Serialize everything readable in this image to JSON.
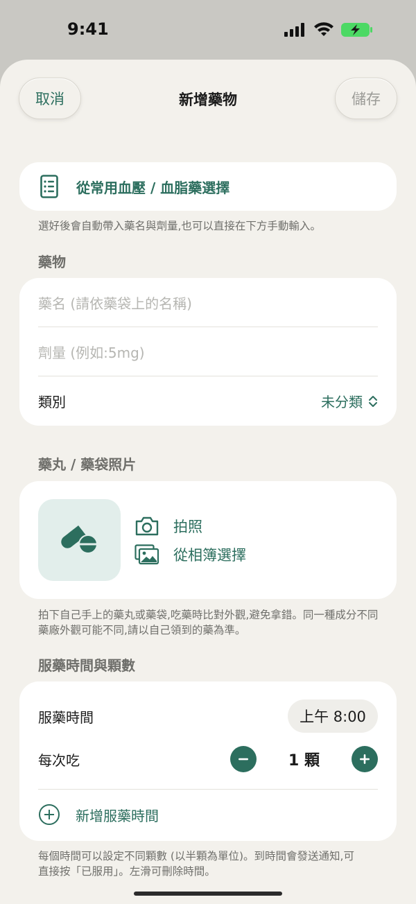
{
  "status": {
    "time": "9:41"
  },
  "nav": {
    "cancel": "取消",
    "title": "新增藥物",
    "save": "儲存"
  },
  "picker": {
    "label": "從常用血壓 / 血脂藥選擇",
    "hint": "選好後會自動帶入藥名與劑量,也可以直接在下方手動輸入。"
  },
  "medication": {
    "section_title": "藥物",
    "name_placeholder": "藥名 (請依藥袋上的名稱)",
    "dose_placeholder": "劑量 (例如:5mg)",
    "category_label": "類別",
    "category_value": "未分類"
  },
  "photo": {
    "section_title": "藥丸 / 藥袋照片",
    "take_photo": "拍照",
    "choose_album": "從相簿選擇",
    "hint": "拍下自己手上的藥丸或藥袋,吃藥時比對外觀,避免拿錯。同一種成分不同藥廠外觀可能不同,請以自己領到的藥為準。"
  },
  "dosage": {
    "section_title": "服藥時間與顆數",
    "time_label": "服藥時間",
    "time_value": "上午 8:00",
    "count_label": "每次吃",
    "count_value": "1 顆",
    "add_time": "新增服藥時間",
    "hint": "每個時間可以設定不同顆數 (以半顆為單位)。到時間會發送通知,可直接按「已服用」。左滑可刪除時間。"
  },
  "colors": {
    "accent": "#2c6e5e",
    "background": "#f3f1ec",
    "card": "#ffffff"
  }
}
